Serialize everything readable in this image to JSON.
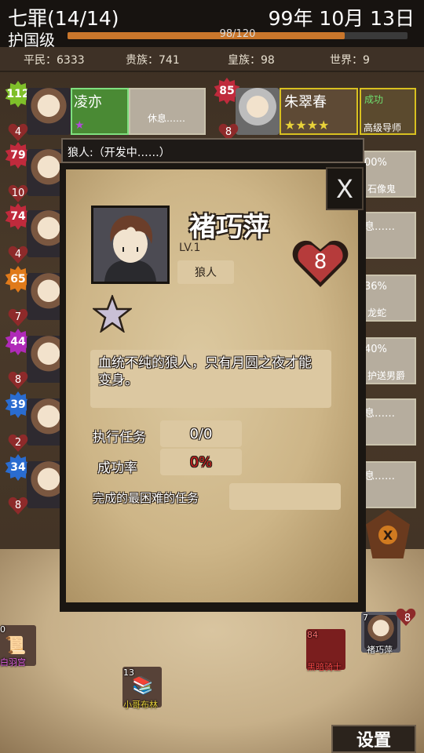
{
  "header": {
    "title": "七罪(14/14)",
    "date": "99年 10月 13日",
    "rank": "护国级",
    "hp_text": "98/120",
    "hp_fraction": 0.816
  },
  "stats": {
    "commoners": "平民：6333",
    "nobles": "贵族：741",
    "royals": "皇族：98",
    "world": "世界：9"
  },
  "roster": [
    {
      "level": "112",
      "hearts": "4",
      "color": "#7fbf2a",
      "card_name": "凌亦",
      "card_status": "休息……"
    },
    {
      "level": "79",
      "hearts": "10",
      "color": "#c02a3c"
    },
    {
      "level": "74",
      "hearts": "4",
      "color": "#c02a3c"
    },
    {
      "level": "65",
      "hearts": "7",
      "color": "#e07a1a"
    },
    {
      "level": "44",
      "hearts": "8",
      "color": "#b02ab8"
    },
    {
      "level": "39",
      "hearts": "2",
      "color": "#2a6cd0"
    },
    {
      "level": "34",
      "hearts": "8",
      "color": "#2a6cd0"
    }
  ],
  "right_roster": {
    "top_level": "85",
    "top_hearts": "8",
    "top_name": "朱翠春",
    "top_task_status": "成功",
    "top_task_label": "高级导师",
    "cards": [
      {
        "text1": "00%",
        "text2": "石像鬼"
      },
      {
        "text1": "息……",
        "text2": ""
      },
      {
        "text1": "36%",
        "text2": "龙蛇"
      },
      {
        "text1": "40%",
        "text2": "护送男爵"
      },
      {
        "text1": "息……",
        "text2": ""
      },
      {
        "text1": "息……",
        "text2": ""
      }
    ]
  },
  "popup": {
    "topbar_text": "狼人:（开发中……）",
    "close_label": "X",
    "name": "褚巧萍",
    "level": "LV.1",
    "class": "狼人",
    "hearts": "8",
    "description": "血统不纯的狼人，只有月圆之夜才能变身。",
    "tasks_label": "执行任务",
    "tasks_value": "0/0",
    "success_label": "成功率",
    "success_value": "0%",
    "hardest_label": "完成的最困难的任务",
    "hardest_value": ""
  },
  "bottom_items": [
    {
      "count": "0",
      "label": "白羽宫"
    },
    {
      "count": "13",
      "label": "小哥布林"
    },
    {
      "count": "84",
      "label": "黑暗骑士"
    },
    {
      "count": "7",
      "label": "褚巧萍",
      "hearts": "8"
    }
  ],
  "settings_label": "设置",
  "colors": {
    "header_bg": "#171310",
    "hp_fill": "#c9762b",
    "parchment": "#cdb587",
    "success_red": "#c81e1e",
    "heart_red": "#b63b3b",
    "gold": "#d8c020"
  },
  "icons": [
    "star-icon",
    "heart-icon",
    "close-icon",
    "scroll-icon",
    "crest-icon"
  ]
}
